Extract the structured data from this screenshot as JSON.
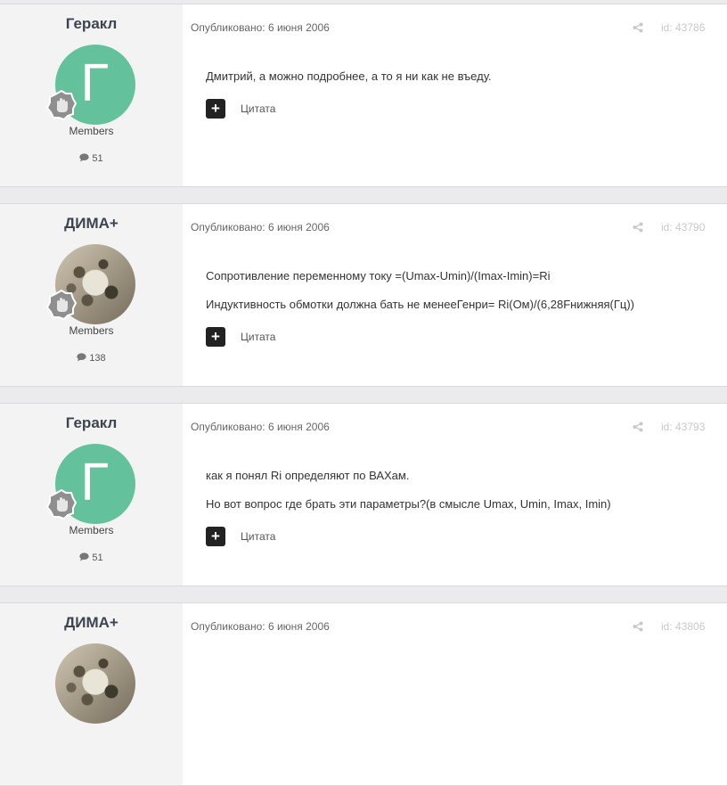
{
  "posts": [
    {
      "author": "Геракл",
      "avatar_letter": "Г",
      "avatar_type": "letter",
      "group": "Members",
      "post_count": "51",
      "published": "Опубликовано: 6 июня 2006",
      "id": "id: 43786",
      "lines": [
        "Дмитрий, а можно подробнее, а то я ни как не въеду."
      ],
      "quote_label": "Цитата"
    },
    {
      "author": "ДИМА+",
      "avatar_type": "photo",
      "group": "Members",
      "post_count": "138",
      "published": "Опубликовано: 6 июня 2006",
      "id": "id: 43790",
      "lines": [
        "Сопротивление переменному току =(Umax-Umin)/(Imax-Imin)=Ri",
        "Индуктивность обмотки должна бать не менееГенри= Ri(Ом)/(6,28Fнижняя(Гц))"
      ],
      "quote_label": "Цитата"
    },
    {
      "author": "Геракл",
      "avatar_letter": "Г",
      "avatar_type": "letter",
      "group": "Members",
      "post_count": "51",
      "published": "Опубликовано: 6 июня 2006",
      "id": "id: 43793",
      "lines": [
        "как я понял Ri определяют по ВАХам.",
        "Но вот вопрос где брать эти параметры?(в смысле Umax, Umin, Imax, Imin)"
      ],
      "quote_label": "Цитата"
    },
    {
      "author": "ДИМА+",
      "avatar_type": "photo",
      "published": "Опубликовано: 6 июня 2006",
      "id": "id: 43806"
    }
  ],
  "icons": {
    "badge": "rank-badge-hand-icon",
    "comment": "comment-bubble-icon",
    "share": "share-icon",
    "quote": "plus-icon"
  },
  "colors": {
    "avatar_letter_bg": "#63c29b",
    "author_panel_bg": "#f3f3f4",
    "page_bg": "#ebebed"
  }
}
